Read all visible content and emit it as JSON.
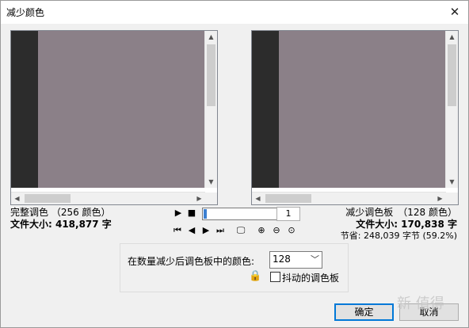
{
  "window": {
    "title": "减少颜色"
  },
  "left_panel": {
    "label": "完整调色 （256 颜色）",
    "size": "文件大小: 418,877 字"
  },
  "right_panel": {
    "label": "减少调色板　（128 颜色）",
    "size": "文件大小: 170,838 字",
    "savings": "节省: 248,039 字节 (59.2%)"
  },
  "playback": {
    "counter": "1",
    "progress": 0.03
  },
  "options": {
    "palette_label": "在数量减少后调色板中的颜色:",
    "palette_value": "128",
    "dither_label": "抖动的调色板",
    "dither_checked": false
  },
  "buttons": {
    "ok": "确定",
    "cancel": "取消"
  },
  "watermark": "新 值得",
  "colors": {
    "preview_gray": "#8b8088",
    "preview_dark": "#2c2c2c",
    "progress": "#3c7fd0",
    "accent": "#0078d7"
  },
  "icons": {
    "play": "▶",
    "stop": "■",
    "first": "⏮",
    "prev": "◀",
    "next": "▶",
    "last": "⏭",
    "monitor": "🖵",
    "zoom_in": "⊕",
    "zoom_out": "⊖",
    "zoom_fit": "⊙",
    "lock": "🔒",
    "close": "✕"
  }
}
